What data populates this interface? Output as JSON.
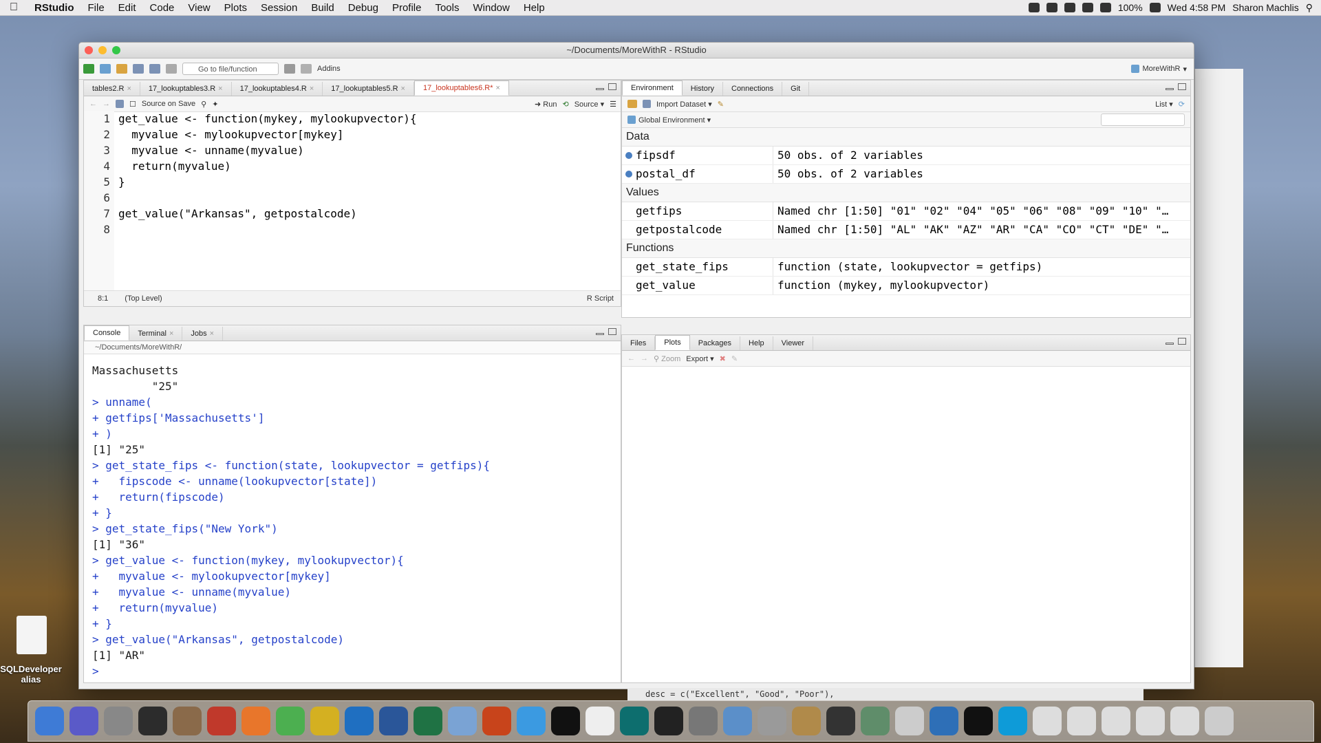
{
  "menubar": {
    "app": "RStudio",
    "items": [
      "File",
      "Edit",
      "Code",
      "View",
      "Plots",
      "Session",
      "Build",
      "Debug",
      "Profile",
      "Tools",
      "Window",
      "Help"
    ],
    "battery": "100%",
    "clock": "Wed 4:58 PM",
    "user": "Sharon Machlis"
  },
  "window": {
    "title": "~/Documents/MoreWithR - RStudio"
  },
  "toolbar": {
    "goto": "Go to file/function",
    "addins": "Addins",
    "project": "MoreWithR"
  },
  "editor": {
    "tabs": [
      "tables2.R",
      "17_lookuptables3.R",
      "17_lookuptables4.R",
      "17_lookuptables5.R",
      "17_lookuptables6.R*"
    ],
    "source_on_save": "Source on Save",
    "run": "Run",
    "source": "Source",
    "lines": [
      {
        "n": "1",
        "text": "get_value <- function(mykey, mylookupvector){"
      },
      {
        "n": "2",
        "text": "  myvalue <- mylookupvector[mykey]"
      },
      {
        "n": "3",
        "text": "  myvalue <- unname(myvalue)"
      },
      {
        "n": "4",
        "text": "  return(myvalue)"
      },
      {
        "n": "5",
        "text": "}"
      },
      {
        "n": "6",
        "text": ""
      },
      {
        "n": "7",
        "text": "get_value(\"Arkansas\", getpostalcode)"
      },
      {
        "n": "8",
        "text": ""
      }
    ],
    "status_pos": "8:1",
    "status_level": "(Top Level)",
    "status_type": "R Script"
  },
  "console": {
    "tabs": [
      "Console",
      "Terminal",
      "Jobs"
    ],
    "path": "~/Documents/MoreWithR/",
    "lines": [
      {
        "t": "Massachusetts",
        "c": "out"
      },
      {
        "t": "         \"25\"",
        "c": "out"
      },
      {
        "t": "> unname(",
        "c": "in"
      },
      {
        "t": "+ getfips['Massachusetts']",
        "c": "in"
      },
      {
        "t": "+ )",
        "c": "in"
      },
      {
        "t": "[1] \"25\"",
        "c": "out"
      },
      {
        "t": "> get_state_fips <- function(state, lookupvector = getfips){",
        "c": "in"
      },
      {
        "t": "+   fipscode <- unname(lookupvector[state])",
        "c": "in"
      },
      {
        "t": "+   return(fipscode)",
        "c": "in"
      },
      {
        "t": "+ }",
        "c": "in"
      },
      {
        "t": "> get_state_fips(\"New York\")",
        "c": "in"
      },
      {
        "t": "[1] \"36\"",
        "c": "out"
      },
      {
        "t": "> get_value <- function(mykey, mylookupvector){",
        "c": "in"
      },
      {
        "t": "+   myvalue <- mylookupvector[mykey]",
        "c": "in"
      },
      {
        "t": "+   myvalue <- unname(myvalue)",
        "c": "in"
      },
      {
        "t": "+   return(myvalue)",
        "c": "in"
      },
      {
        "t": "+ }",
        "c": "in"
      },
      {
        "t": "> get_value(\"Arkansas\", getpostalcode)",
        "c": "in"
      },
      {
        "t": "[1] \"AR\"",
        "c": "out"
      },
      {
        "t": "> ",
        "c": "in"
      }
    ]
  },
  "env": {
    "tabs": [
      "Environment",
      "History",
      "Connections",
      "Git"
    ],
    "import": "Import Dataset",
    "list": "List",
    "scope": "Global Environment",
    "sections": {
      "data": "Data",
      "values": "Values",
      "functions": "Functions"
    },
    "data": [
      {
        "name": "fipsdf",
        "value": "50 obs. of 2 variables"
      },
      {
        "name": "postal_df",
        "value": "50 obs. of 2 variables"
      }
    ],
    "values": [
      {
        "name": "getfips",
        "value": "Named chr [1:50] \"01\" \"02\" \"04\" \"05\" \"06\" \"08\" \"09\" \"10\" \"…"
      },
      {
        "name": "getpostalcode",
        "value": "Named chr [1:50] \"AL\" \"AK\" \"AZ\" \"AR\" \"CA\" \"CO\" \"CT\" \"DE\" \"…"
      }
    ],
    "functions": [
      {
        "name": "get_state_fips",
        "value": "function (state, lookupvector = getfips)"
      },
      {
        "name": "get_value",
        "value": "function (mykey, mylookupvector)"
      }
    ]
  },
  "files": {
    "tabs": [
      "Files",
      "Plots",
      "Packages",
      "Help",
      "Viewer"
    ],
    "zoom": "Zoom",
    "export": "Export"
  },
  "desktop": {
    "label": "SQLDeveloper alias",
    "bg_code": "desc = c(\"Excellent\", \"Good\", \"Poor\"),"
  },
  "colors": {
    "accent_tab": "#c8341f",
    "code_keyword": "#1c3fd6",
    "console_input": "#2541c9"
  }
}
